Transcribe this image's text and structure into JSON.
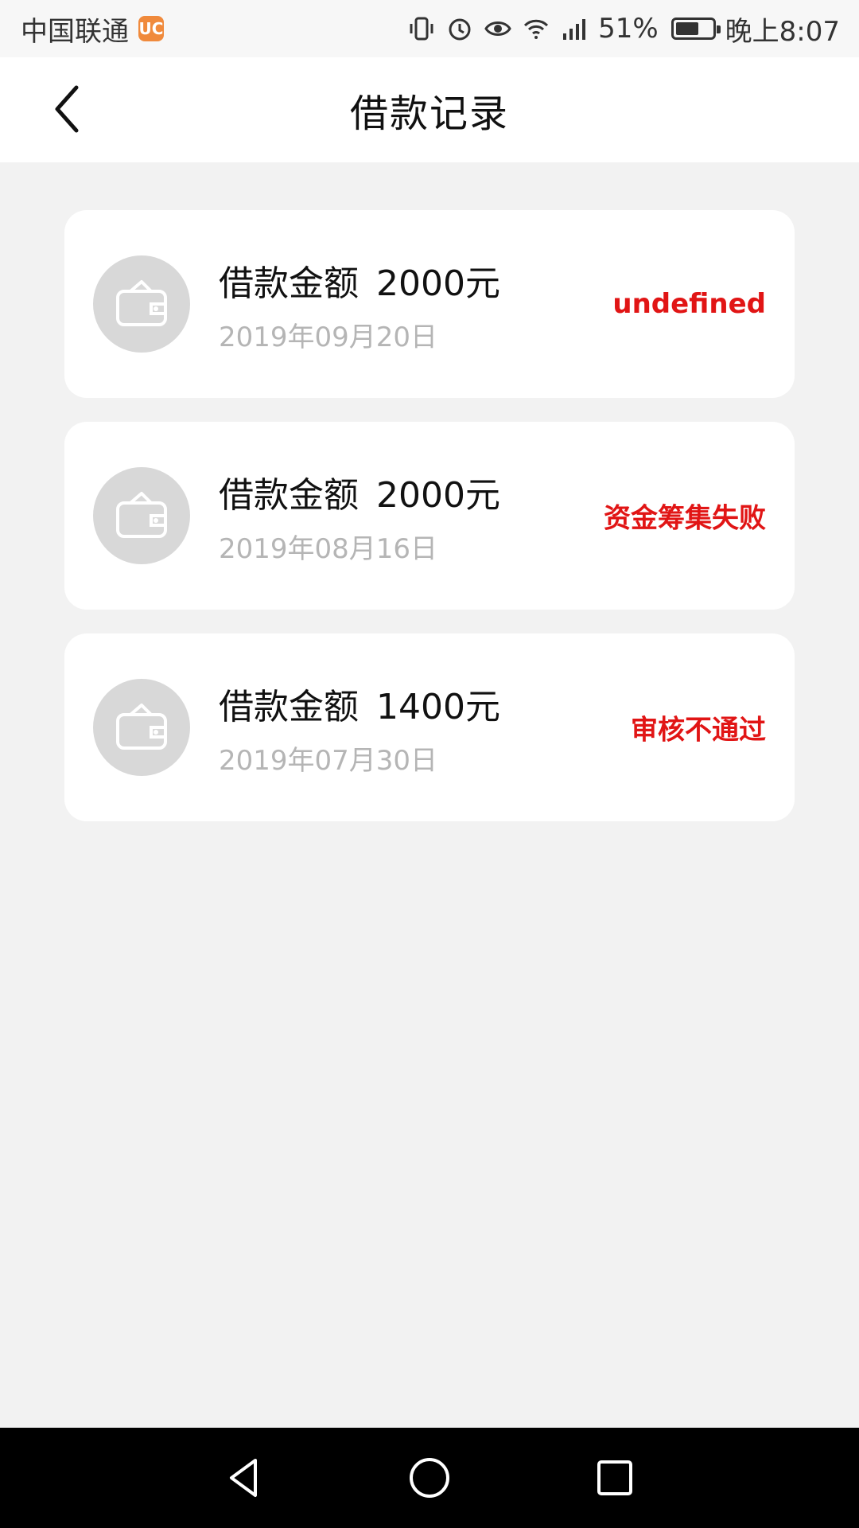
{
  "status_bar": {
    "carrier": "中国联通",
    "battery_pct": "51%",
    "time": "晚上8:07",
    "icons": [
      "vibrate-icon",
      "alarm-icon",
      "eye-icon",
      "wifi-icon",
      "signal-icon",
      "battery-icon"
    ]
  },
  "header": {
    "title": "借款记录"
  },
  "records": [
    {
      "label": "借款金额",
      "amount": "2000元",
      "date": "2019年09月20日",
      "status": "undefined"
    },
    {
      "label": "借款金额",
      "amount": "2000元",
      "date": "2019年08月16日",
      "status": "资金筹集失败"
    },
    {
      "label": "借款金额",
      "amount": "1400元",
      "date": "2019年07月30日",
      "status": "审核不通过"
    }
  ],
  "colors": {
    "status_text": "#e11515",
    "background": "#f2f2f2",
    "card": "#ffffff",
    "avatar": "#d8d8d8",
    "date_text": "#b5b5b5"
  }
}
